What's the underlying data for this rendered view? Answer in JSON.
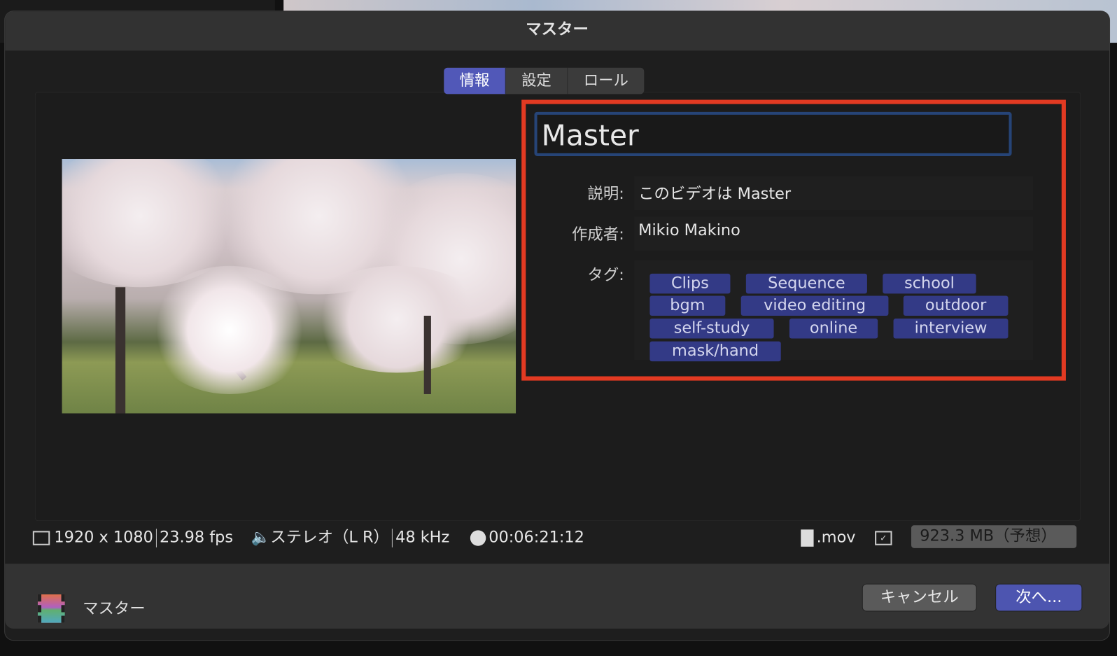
{
  "dialog": {
    "title": "マスター"
  },
  "tabs": [
    {
      "label": "情報",
      "active": true
    },
    {
      "label": "設定"
    },
    {
      "label": "ロール"
    }
  ],
  "info": {
    "name": "Master",
    "description_label": "説明:",
    "description": "このビデオは Master",
    "creator_label": "作成者:",
    "creator": "Mikio Makino",
    "tags_label": "タグ:",
    "tags": [
      "Clips",
      "Sequence",
      "school",
      "bgm",
      "video editing",
      "outdoor",
      "self-study",
      "online",
      "interview",
      "mask/hand"
    ]
  },
  "status": {
    "resolution": "1920 x 1080",
    "fps": "23.98 fps",
    "audio": "ステレオ（L R）",
    "sample_rate": "48 kHz",
    "duration": "00:06:21:12",
    "extension": ".mov",
    "size": "923.3 MB（予想）"
  },
  "footer": {
    "name": "マスター",
    "cancel": "キャンセル",
    "next": "次へ..."
  },
  "colors": {
    "accent": "#5158b8",
    "tag": "#333a86",
    "highlight": "#e23a22"
  }
}
